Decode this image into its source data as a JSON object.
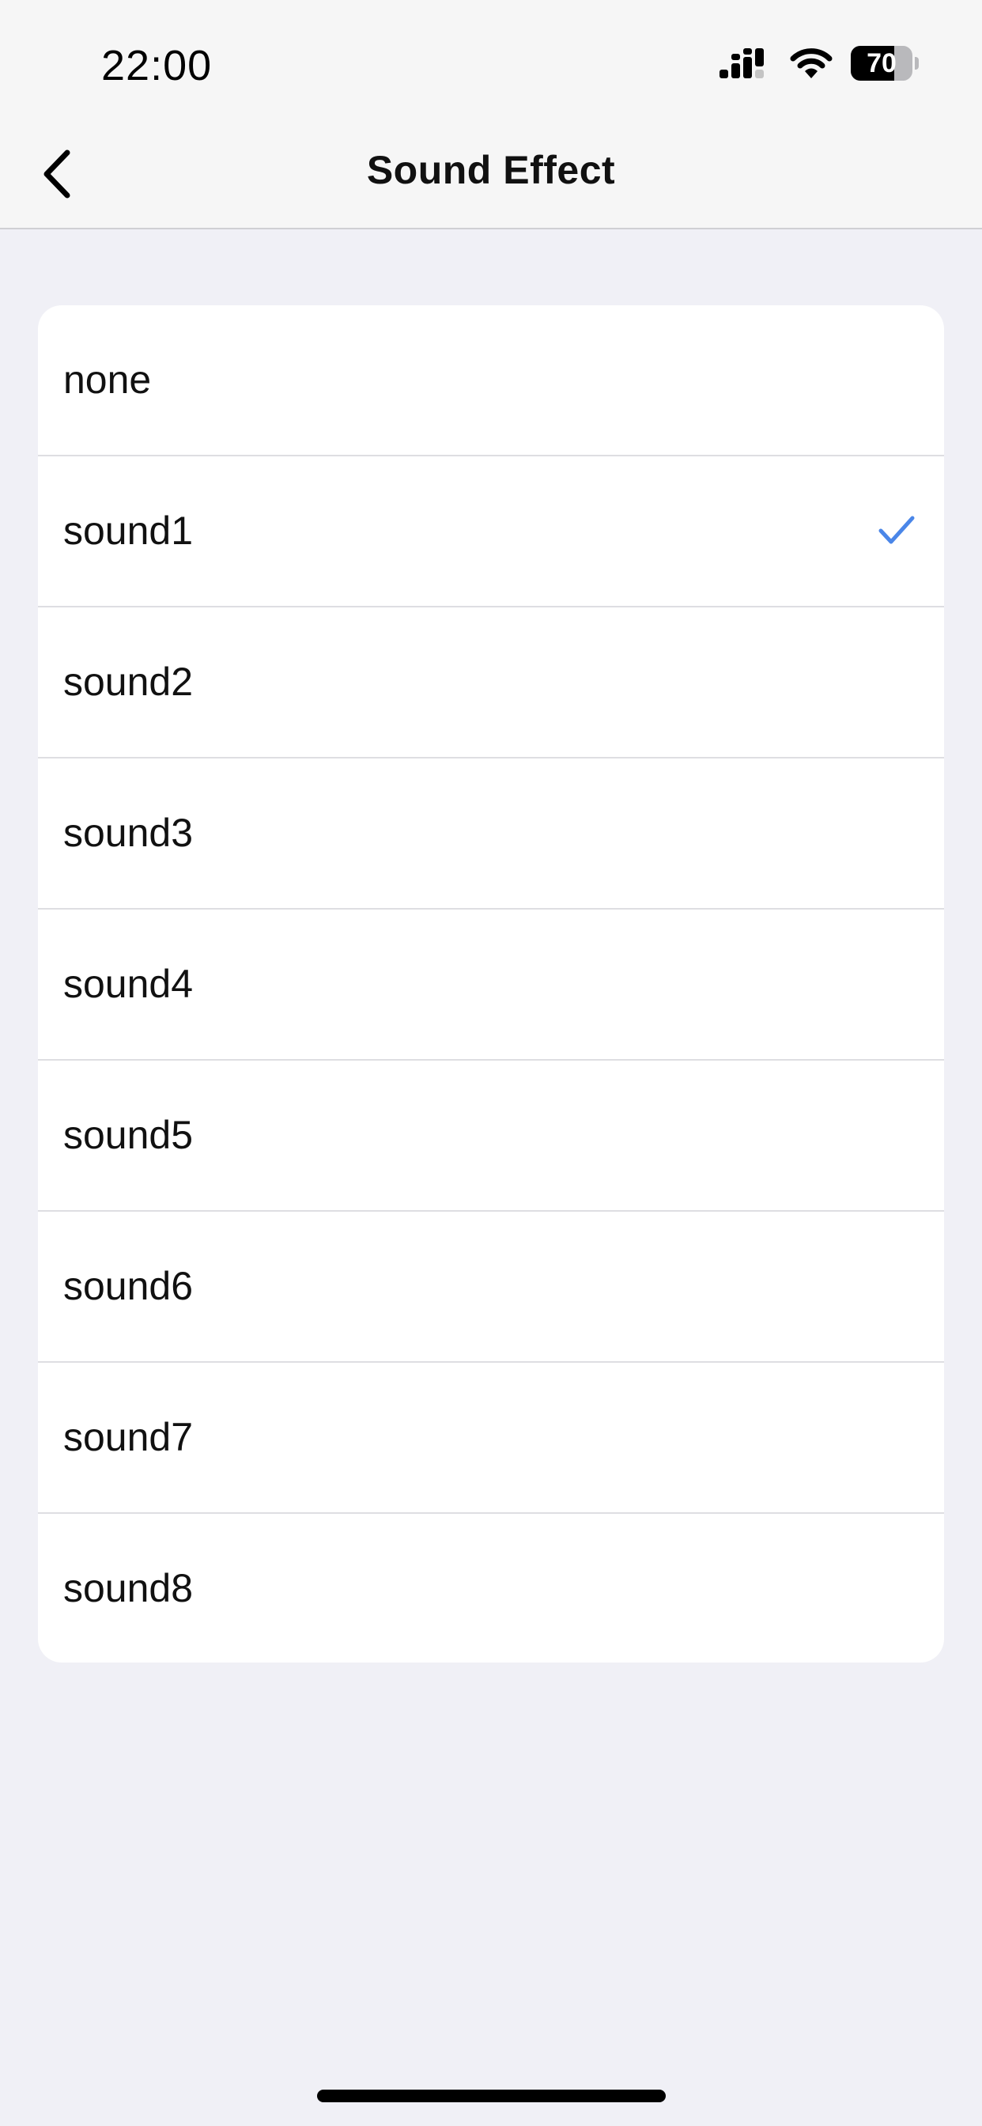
{
  "status_bar": {
    "time": "22:00",
    "battery_level": "70",
    "icons": [
      "cellular-signal-icon",
      "wifi-icon",
      "battery-icon"
    ]
  },
  "nav": {
    "title": "Sound Effect",
    "back_icon": "chevron-left-icon"
  },
  "options": [
    {
      "label": "none"
    },
    {
      "label": "sound1",
      "selected": true
    },
    {
      "label": "sound2"
    },
    {
      "label": "sound3"
    },
    {
      "label": "sound4"
    },
    {
      "label": "sound5"
    },
    {
      "label": "sound6"
    },
    {
      "label": "sound7"
    },
    {
      "label": "sound8"
    }
  ],
  "colors": {
    "accent": "#4a86e8",
    "background": "#f0f0f6",
    "card": "#ffffff",
    "header": "#f6f6f6"
  }
}
